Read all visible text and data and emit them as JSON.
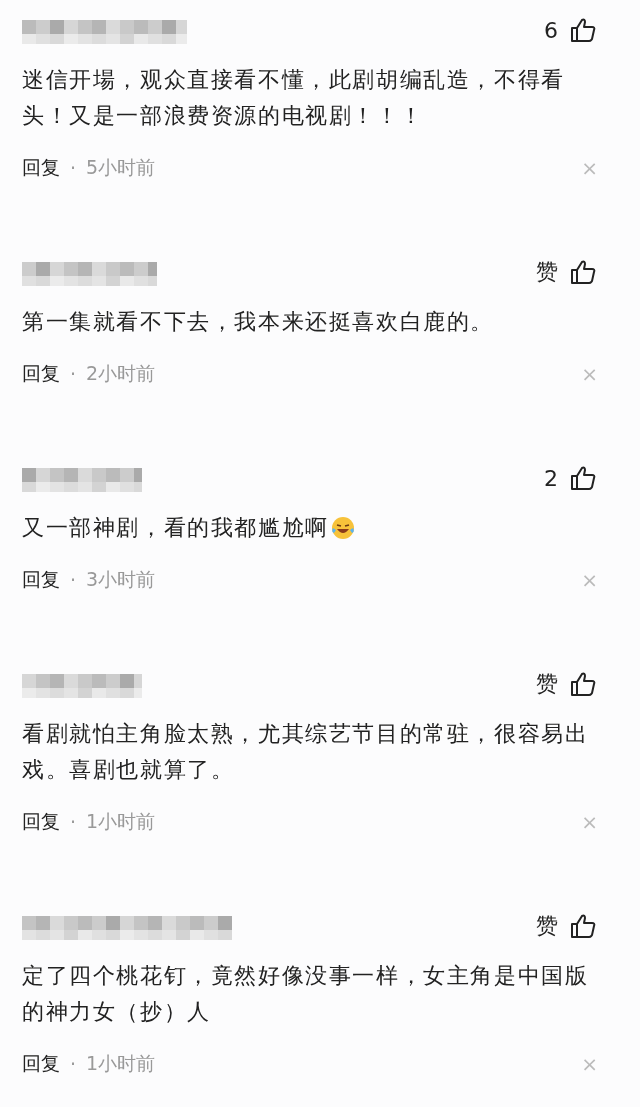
{
  "comments": [
    {
      "like_label": "6",
      "text": "迷信开場，观众直接看不懂，此剧胡编乱造，不得看头！又是一部浪费资源的电视剧！！！",
      "reply": "回复",
      "separator": "·",
      "time": "5小时前",
      "close": "×"
    },
    {
      "like_label": "赞",
      "text": "第一集就看不下去，我本来还挺喜欢白鹿的。",
      "reply": "回复",
      "separator": "·",
      "time": "2小时前",
      "close": "×"
    },
    {
      "like_label": "2",
      "text": "又一部神剧，看的我都尴尬啊",
      "trailing_emoji": true,
      "reply": "回复",
      "separator": "·",
      "time": "3小时前",
      "close": "×"
    },
    {
      "like_label": "赞",
      "text": "看剧就怕主角脸太熟，尤其综艺节目的常驻，很容易出戏。喜剧也就算了。",
      "reply": "回复",
      "separator": "·",
      "time": "1小时前",
      "close": "×"
    },
    {
      "like_label": "赞",
      "text": "定了四个桃花钉，竟然好像没事一样，女主角是中国版的神力女（抄）人",
      "reply": "回复",
      "separator": "·",
      "time": "1小时前",
      "close": "×"
    }
  ]
}
